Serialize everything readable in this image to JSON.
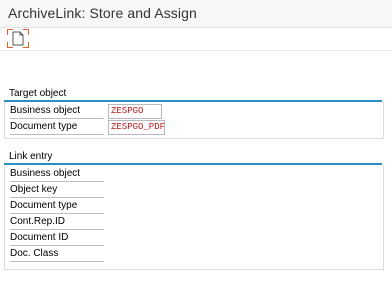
{
  "window": {
    "title": "ArchiveLink: Store and Assign"
  },
  "toolbar": {
    "buttons": [
      {
        "icon": "document-icon",
        "label": ""
      }
    ]
  },
  "target_object": {
    "title": "Target object",
    "rows": [
      {
        "label": "Business object",
        "value": "ZESPGO"
      },
      {
        "label": "Document type",
        "value": "ZESPGO_PDF"
      }
    ]
  },
  "link_entry": {
    "title": "Link entry",
    "rows": [
      {
        "label": "Business object",
        "value": ""
      },
      {
        "label": "Object key",
        "value": ""
      },
      {
        "label": "Document type",
        "value": ""
      },
      {
        "label": "Cont.Rep.ID",
        "value": ""
      },
      {
        "label": "Document ID",
        "value": ""
      },
      {
        "label": "Doc. Class",
        "value": ""
      }
    ]
  },
  "colors": {
    "accent": "#2b8fc7",
    "value_text": "#c01818",
    "focus_corner": "#e2631f"
  }
}
